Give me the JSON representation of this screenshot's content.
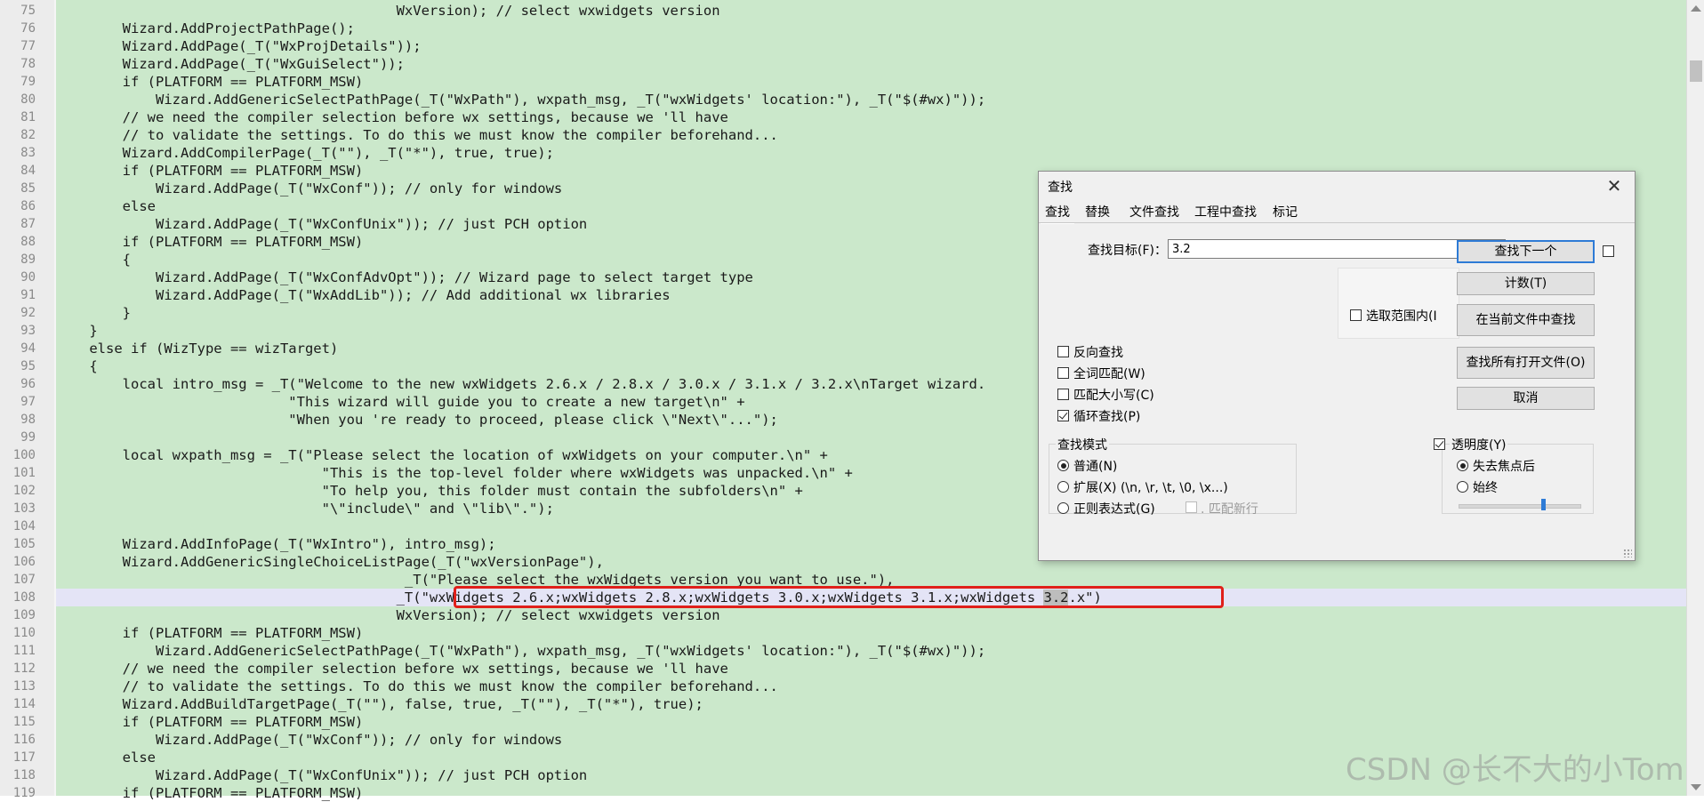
{
  "editor": {
    "lines": [
      {
        "n": "75",
        "t": "                                         WxVersion); // select wxwidgets version"
      },
      {
        "n": "76",
        "t": "        Wizard.AddProjectPathPage();"
      },
      {
        "n": "77",
        "t": "        Wizard.AddPage(_T(\"WxProjDetails\"));"
      },
      {
        "n": "78",
        "t": "        Wizard.AddPage(_T(\"WxGuiSelect\"));"
      },
      {
        "n": "79",
        "t": "        if (PLATFORM == PLATFORM_MSW)"
      },
      {
        "n": "80",
        "t": "            Wizard.AddGenericSelectPathPage(_T(\"WxPath\"), wxpath_msg, _T(\"wxWidgets' location:\"), _T(\"$(#wx)\"));"
      },
      {
        "n": "81",
        "t": "        // we need the compiler selection before wx settings, because we 'll have"
      },
      {
        "n": "82",
        "t": "        // to validate the settings. To do this we must know the compiler beforehand..."
      },
      {
        "n": "83",
        "t": "        Wizard.AddCompilerPage(_T(\"\"), _T(\"*\"), true, true);"
      },
      {
        "n": "84",
        "t": "        if (PLATFORM == PLATFORM_MSW)"
      },
      {
        "n": "85",
        "t": "            Wizard.AddPage(_T(\"WxConf\")); // only for windows"
      },
      {
        "n": "86",
        "t": "        else"
      },
      {
        "n": "87",
        "t": "            Wizard.AddPage(_T(\"WxConfUnix\")); // just PCH option"
      },
      {
        "n": "88",
        "t": "        if (PLATFORM == PLATFORM_MSW)"
      },
      {
        "n": "89",
        "t": "        {"
      },
      {
        "n": "90",
        "t": "            Wizard.AddPage(_T(\"WxConfAdvOpt\")); // Wizard page to select target type"
      },
      {
        "n": "91",
        "t": "            Wizard.AddPage(_T(\"WxAddLib\")); // Add additional wx libraries"
      },
      {
        "n": "92",
        "t": "        }"
      },
      {
        "n": "93",
        "t": "    }"
      },
      {
        "n": "94",
        "t": "    else if (WizType == wizTarget)"
      },
      {
        "n": "95",
        "t": "    {"
      },
      {
        "n": "96",
        "t": "        local intro_msg = _T(\"Welcome to the new wxWidgets 2.6.x / 2.8.x / 3.0.x / 3.1.x / 3.2.x\\nTarget wizard."
      },
      {
        "n": "97",
        "t": "                            \"This wizard will guide you to create a new target\\n\" +"
      },
      {
        "n": "98",
        "t": "                            \"When you 're ready to proceed, please click \\\"Next\\\"...\");"
      },
      {
        "n": "99",
        "t": ""
      },
      {
        "n": "100",
        "t": "        local wxpath_msg = _T(\"Please select the location of wxWidgets on your computer.\\n\" +"
      },
      {
        "n": "101",
        "t": "                                \"This is the top-level folder where wxWidgets was unpacked.\\n\" +"
      },
      {
        "n": "102",
        "t": "                                \"To help you, this folder must contain the subfolders\\n\" +"
      },
      {
        "n": "103",
        "t": "                                \"\\\"include\\\" and \\\"lib\\\".\");"
      },
      {
        "n": "104",
        "t": ""
      },
      {
        "n": "105",
        "t": "        Wizard.AddInfoPage(_T(\"WxIntro\"), intro_msg);"
      },
      {
        "n": "106",
        "t": "        Wizard.AddGenericSingleChoiceListPage(_T(\"wxVersionPage\"),"
      },
      {
        "n": "107",
        "t": "                                          _T(\"Please select the wxWidgets version you want to use.\"),"
      },
      {
        "n": "108",
        "t": "                                         _T(\"wxWidgets 2.6.x;wxWidgets 2.8.x;wxWidgets 3.0.x;wxWidgets 3.1.x;wxWidgets 3.2.x\")"
      },
      {
        "n": "109",
        "t": "                                         WxVersion); // select wxwidgets version"
      },
      {
        "n": "110",
        "t": "        if (PLATFORM == PLATFORM_MSW)"
      },
      {
        "n": "111",
        "t": "            Wizard.AddGenericSelectPathPage(_T(\"WxPath\"), wxpath_msg, _T(\"wxWidgets' location:\"), _T(\"$(#wx)\"));"
      },
      {
        "n": "112",
        "t": "        // we need the compiler selection before wx settings, because we 'll have"
      },
      {
        "n": "113",
        "t": "        // to validate the settings. To do this we must know the compiler beforehand..."
      },
      {
        "n": "114",
        "t": "        Wizard.AddBuildTargetPage(_T(\"\"), false, true, _T(\"\"), _T(\"*\"), true);"
      },
      {
        "n": "115",
        "t": "        if (PLATFORM == PLATFORM_MSW)"
      },
      {
        "n": "116",
        "t": "            Wizard.AddPage(_T(\"WxConf\")); // only for windows"
      },
      {
        "n": "117",
        "t": "        else"
      },
      {
        "n": "118",
        "t": "            Wizard.AddPage(_T(\"WxConfUnix\")); // just PCH option"
      },
      {
        "n": "119",
        "t": "        if (PLATFORM == PLATFORM_MSW)"
      }
    ],
    "current_line": "108",
    "match_prefix": "                                         _T(\"wxWidgets 2.6.x;wxWidgets 2.8.x;wxWidgets 3.0.x;wxWidgets 3.1.x;wxWidgets ",
    "match_text": "3.2",
    "match_suffix": ".x\")",
    "colors": {
      "background": "#cbe8cb",
      "current_line": "#e4e4f6",
      "highlight_box": "#e0201a"
    }
  },
  "watermark": "CSDN @长不大的小Tom",
  "dialog": {
    "title": "查找",
    "close": "✕",
    "tabs": [
      "查找",
      "替换",
      "文件查找",
      "工程中查找",
      "标记"
    ],
    "target_label": "查找目标(F)：",
    "target_value": "3.2",
    "find_next": "查找下一个",
    "count": "计数(T)",
    "in_selection": "选取范围内(I",
    "find_in_current": "在当前文件中查找",
    "find_all_open": "查找所有打开文件(O)",
    "cancel": "取消",
    "options": [
      {
        "label": "反向查找",
        "checked": false
      },
      {
        "label": "全词匹配(W)",
        "checked": false
      },
      {
        "label": "匹配大小写(C)",
        "checked": false
      },
      {
        "label": "循环查找(P)",
        "checked": true
      }
    ],
    "mode_title": "查找模式",
    "modes": [
      {
        "label": "普通(N)",
        "checked": true
      },
      {
        "label": "扩展(X) (\\n, \\r, \\t, \\0, \\x...)",
        "checked": false
      },
      {
        "label": "正则表达式(G)",
        "checked": false
      }
    ],
    "match_newline": ". 匹配新行",
    "transparency": "透明度(Y)",
    "trans_modes": [
      {
        "label": "失去焦点后",
        "checked": true
      },
      {
        "label": "始终",
        "checked": false
      }
    ],
    "transparency_level": 0.7
  }
}
